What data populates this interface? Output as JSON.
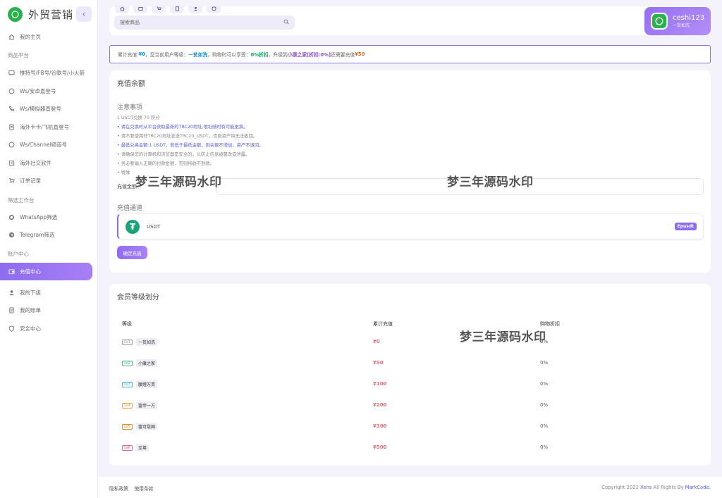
{
  "brand": {
    "name": "外贸营销"
  },
  "sidebar": {
    "items": [
      {
        "label": "我的主页",
        "icon": "home-icon"
      },
      {
        "section": "商品平台"
      },
      {
        "label": "推特号/FB号/谷歌号/小火箭",
        "icon": "chat-icon"
      },
      {
        "label": "Ws/安卓直登号",
        "icon": "whatsapp-icon"
      },
      {
        "label": "Ws/模拟器直登号",
        "icon": "phone-icon"
      },
      {
        "label": "海外卡卡/飞机直登号",
        "icon": "document-icon"
      },
      {
        "label": "Ws/Channel频道号",
        "icon": "whatsapp-icon"
      },
      {
        "label": "海外社交软件",
        "icon": "app-icon"
      },
      {
        "label": "订单记录",
        "icon": "cart-icon"
      },
      {
        "section": "筛选工作台"
      },
      {
        "label": "WhatsApp筛选",
        "icon": "whatsapp-icon"
      },
      {
        "label": "Telegram筛选",
        "icon": "telegram-icon"
      },
      {
        "section": "账户中心"
      },
      {
        "label": "充值中心",
        "icon": "wallet-icon",
        "active": true
      },
      {
        "label": "我的下级",
        "icon": "user-icon"
      },
      {
        "label": "我的账单",
        "icon": "bill-icon"
      },
      {
        "label": "安全中心",
        "icon": "shield-icon"
      }
    ]
  },
  "header": {
    "search_placeholder": "搜索商品",
    "user": {
      "name": "ceshi123",
      "level": "一贫如洗"
    }
  },
  "notice": {
    "p1": "累计充值:",
    "total": "¥0",
    "p2": "，您当前用户等级：",
    "level": "一贫如洗",
    "p3": "，购物时可以享受：",
    "discount": "0%折扣",
    "p4": "，升级到",
    "next": "小康之家[折扣:0%]",
    "p5": "还需要充值",
    "need": "¥50"
  },
  "recharge": {
    "title": "充值余额",
    "notes_title": "注意事项",
    "rate": "1 USDT兑换 70 积分",
    "rules": [
      "• 请在兑换时从平台获取最新的TRC20地址,地址随时有可能更换。",
      "• 请不要使用非TRC20地址发送TRC20_USDT，否则资产将无法收回。",
      "• 最低兑换金额:1 USDT，若低于最低金额，则余额不增加，资产不退回。",
      "• 请确保您的计算机和浏览器是安全的，以防止信息被篡改或泄露。",
      "• 务必要输入正确的付款金额，否则将收不到款。",
      "• 特殊"
    ],
    "amount_label": "充值金额",
    "channel_title": "充值通道",
    "channel_name": "USDT",
    "channel_badge": "Epusdt",
    "confirm": "确定充值"
  },
  "levels": {
    "title": "会员等级划分",
    "headers": [
      "等级",
      "累计充值",
      "购物折扣"
    ],
    "rows": [
      {
        "badge": "LV1",
        "name": "一贫如洗",
        "amount": "¥0",
        "discount": "0%",
        "color": "#9a9a9a"
      },
      {
        "badge": "LV2",
        "name": "小康之家",
        "amount": "¥50",
        "discount": "0%",
        "color": "#3bb98a"
      },
      {
        "badge": "LV3",
        "name": "腰缠万贯",
        "amount": "¥100",
        "discount": "0%",
        "color": "#3fb0d6"
      },
      {
        "badge": "LV4",
        "name": "富甲一方",
        "amount": "¥200",
        "discount": "0%",
        "color": "#f0a03a"
      },
      {
        "badge": "LV5",
        "name": "富可敌国",
        "amount": "¥300",
        "discount": "0%",
        "color": "#e08a1e"
      },
      {
        "badge": "LV6",
        "name": "至尊",
        "amount": "¥500",
        "discount": "0%",
        "color": "#e2609a"
      }
    ]
  },
  "watermark": "梦三年源码水印",
  "footer": {
    "privacy": "隐私政策",
    "terms": "使用条款",
    "copyright_prefix": "Copyright 2022",
    "brand": "Xens",
    "rights": "All Rights By",
    "author": "MarkCode."
  }
}
